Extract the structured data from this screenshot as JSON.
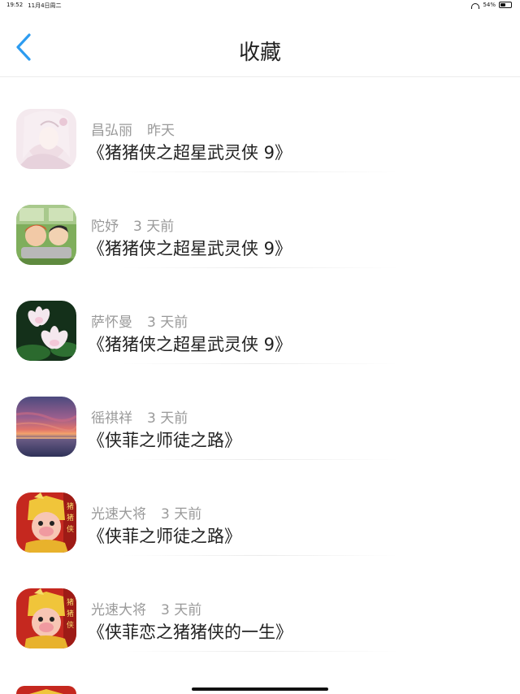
{
  "status_bar": {
    "time": "19:52",
    "date": "11月4日周二",
    "battery": "54%",
    "battery_level": 0.54
  },
  "nav": {
    "title": "收藏",
    "back_icon": "chevron-left-icon",
    "accent_color": "#2d9cf0"
  },
  "favorites": [
    {
      "user": "昌弘丽",
      "time": "昨天",
      "title": "《猪猪侠之超星武灵侠 9》",
      "avatar": "anime-girl"
    },
    {
      "user": "陀妤",
      "time": "3 天前",
      "title": "《猪猪侠之超星武灵侠 9》",
      "avatar": "anime-kids"
    },
    {
      "user": "萨怀曼",
      "time": "3 天前",
      "title": "《猪猪侠之超星武灵侠 9》",
      "avatar": "lotus"
    },
    {
      "user": "徭祺祥",
      "time": "3 天前",
      "title": "《侠菲之师徒之路》",
      "avatar": "sunset"
    },
    {
      "user": "光速大将",
      "time": "3 天前",
      "title": "《侠菲之师徒之路》",
      "avatar": "pig-hero"
    },
    {
      "user": "光速大将",
      "time": "3 天前",
      "title": "《侠菲恋之猪猪侠的一生》",
      "avatar": "pig-hero"
    }
  ]
}
